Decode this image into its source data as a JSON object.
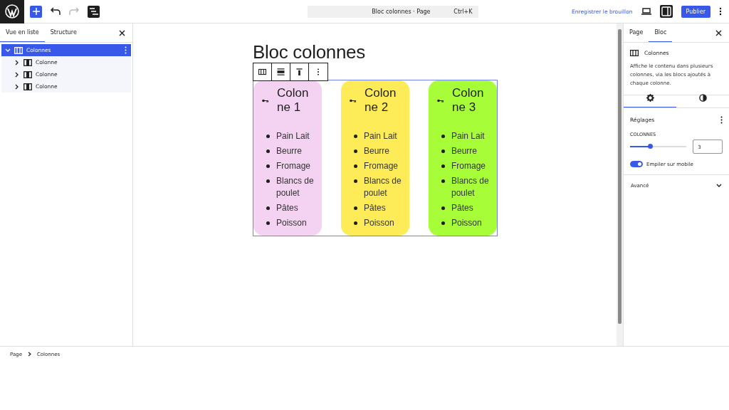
{
  "topbar": {
    "document_title": "Bloc colonnes · Page",
    "shortcut": "Ctrl+K",
    "save_draft": "Enregistrer le brouillon",
    "publish": "Publier",
    "settings_open": true
  },
  "list_panel": {
    "tabs": [
      {
        "label": "Vue en liste",
        "selected": true
      },
      {
        "label": "Structure",
        "selected": false
      }
    ],
    "tree": [
      {
        "label": "Colonnes",
        "selected": true,
        "expanded": true,
        "children": [
          {
            "label": "Colonne",
            "selected": false,
            "expanded": false
          },
          {
            "label": "Colonne",
            "selected": false,
            "expanded": false
          },
          {
            "label": "Colonne",
            "selected": false,
            "expanded": false
          }
        ]
      }
    ]
  },
  "canvas": {
    "title": "Bloc colonnes",
    "columns": [
      {
        "heading": "Colonne 1",
        "color": "#f4d2f1",
        "items": [
          "Pain Lait",
          "Beurre",
          "Fromage",
          "Blancs de poulet",
          "Pâtes",
          "Poisson"
        ]
      },
      {
        "heading": "Colonne 2",
        "color": "#fdec57",
        "items": [
          "Pain Lait",
          "Beurre",
          "Fromage",
          "Blancs de poulet",
          "Pâtes",
          "Poisson"
        ]
      },
      {
        "heading": "Colonne 3",
        "color": "#a7fd37",
        "items": [
          "Pain Lait",
          "Beurre",
          "Fromage",
          "Blancs de poulet",
          "Pâtes",
          "Poisson"
        ]
      }
    ]
  },
  "settings_panel": {
    "tabs": [
      {
        "label": "Page",
        "selected": false
      },
      {
        "label": "Bloc",
        "selected": true
      }
    ],
    "block_name": "Colonnes",
    "block_description": "Affiche le contenu dans plusieurs colonnes, via les blocs ajoutés à chaque colonne.",
    "section_title": "Réglages",
    "columns_label": "COLONNES",
    "columns_slider": {
      "level": 0.35
    },
    "columns_value": "3",
    "stack_on_mobile": {
      "label": "Empiler sur mobile",
      "on": true
    },
    "advanced": {
      "label": "Avancé",
      "expanded": false
    }
  },
  "breadcrumb": [
    "Page",
    "Colonnes"
  ]
}
